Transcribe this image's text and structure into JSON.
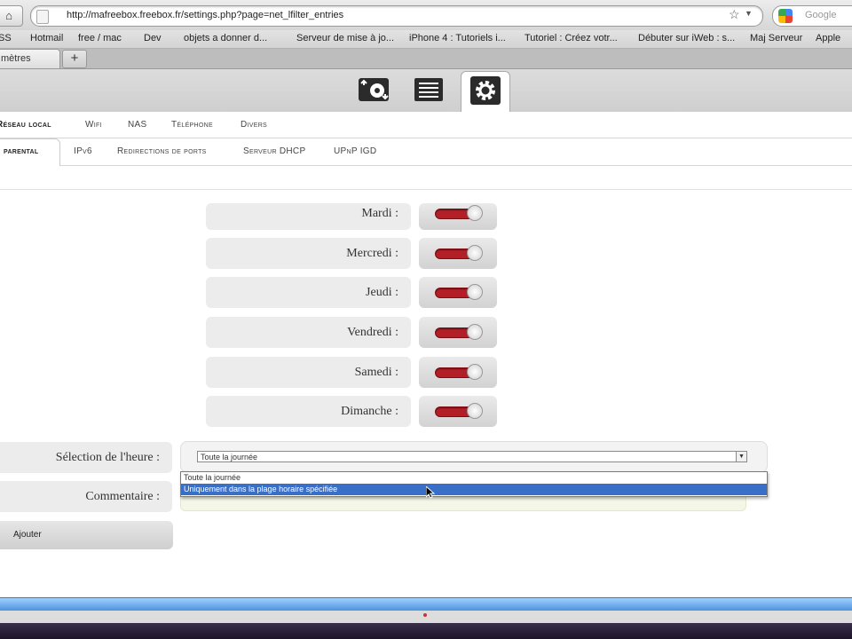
{
  "browser": {
    "url": "http://mafreebox.freebox.fr/settings.php?page=net_lfilter_entries",
    "search_placeholder": "Google",
    "bookmarks": [
      "SS",
      "Hotmail",
      "free / mac",
      "Dev",
      "objets a donner d...",
      "Serveur de mise à jo...",
      "iPhone 4 : Tutoriels i...",
      "Tutoriel : Créez votr...",
      "Débuter sur iWeb : s...",
      "Maj Serveur",
      "Apple"
    ],
    "tab_title": "mètres",
    "new_tab": "+"
  },
  "top_icons": [
    {
      "name": "downloads-icon"
    },
    {
      "name": "files-icon"
    },
    {
      "name": "settings-gear-icon"
    }
  ],
  "tabs_row1": [
    "Réseau local",
    "Wifi",
    "NAS",
    "Téléphone",
    "Divers"
  ],
  "tabs_row2": [
    "parental",
    "IPv6",
    "Redirections de ports",
    "Serveur DHCP",
    "UPnP IGD"
  ],
  "days": [
    {
      "label": "Mardi :",
      "enabled": true
    },
    {
      "label": "Mercredi :",
      "enabled": true
    },
    {
      "label": "Jeudi :",
      "enabled": true
    },
    {
      "label": "Vendredi :",
      "enabled": true
    },
    {
      "label": "Samedi :",
      "enabled": true
    },
    {
      "label": "Dimanche :",
      "enabled": true
    }
  ],
  "form": {
    "time_label": "Sélection de l'heure :",
    "time_selected": "Toute la journée",
    "time_options": [
      "Toute la journée",
      "Uniquement dans la plage horaire spécifiée"
    ],
    "comment_label": "Commentaire :",
    "add_button": "Ajouter"
  },
  "colors": {
    "toggle_on": "#b21f27",
    "highlight": "#3a6fc7"
  }
}
